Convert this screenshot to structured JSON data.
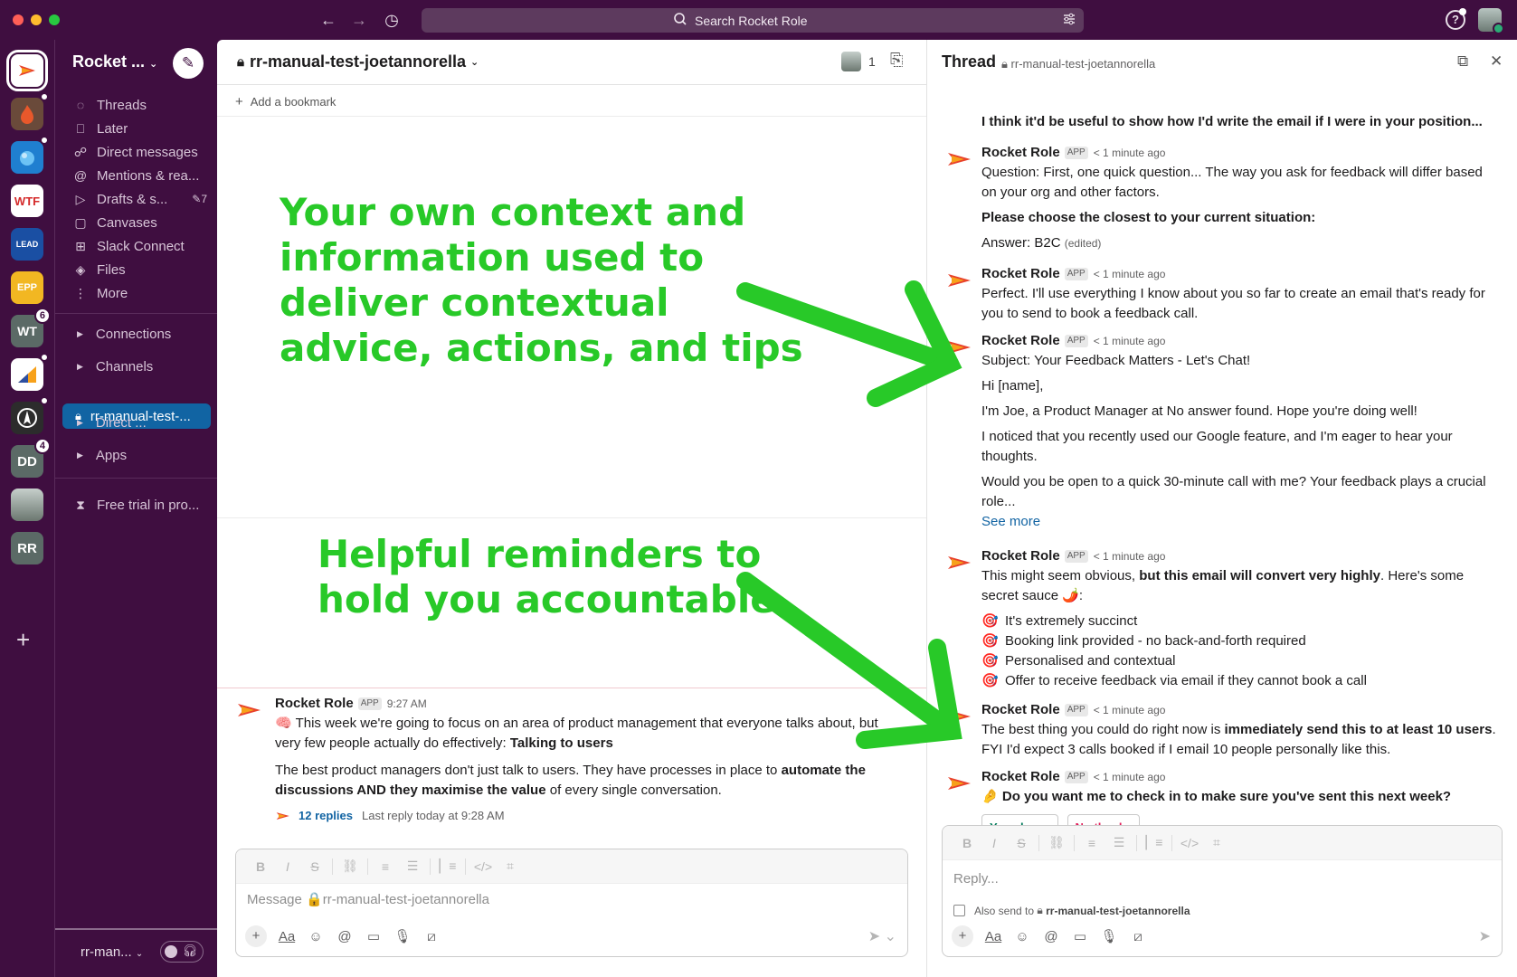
{
  "topbar": {
    "search_placeholder": "Search Rocket Role",
    "back_icon": "arrow-left-icon",
    "forward_icon": "arrow-right-icon",
    "history_icon": "clock-icon"
  },
  "rail": {
    "workspaces": [
      {
        "initials": "",
        "badge": ""
      },
      {
        "initials": "",
        "badge": ""
      },
      {
        "initials": "",
        "badge": ""
      },
      {
        "initials": "WTF",
        "badge": ""
      },
      {
        "initials": "LEAD",
        "badge": ""
      },
      {
        "initials": "EPP",
        "badge": ""
      },
      {
        "initials": "WT",
        "badge": "6"
      },
      {
        "initials": "",
        "badge": ""
      },
      {
        "initials": "",
        "badge": ""
      },
      {
        "initials": "DD",
        "badge": "4"
      },
      {
        "initials": "",
        "badge": ""
      },
      {
        "initials": "RR",
        "badge": ""
      }
    ],
    "add_label": "+"
  },
  "sidebar": {
    "workspace_name": "Rocket ...",
    "nav": [
      {
        "label": "Threads",
        "icon": "threads-icon"
      },
      {
        "label": "Later",
        "icon": "bookmark-icon"
      },
      {
        "label": "Direct messages",
        "icon": "dm-icon"
      },
      {
        "label": "Mentions & rea...",
        "icon": "at-icon"
      },
      {
        "label": "Drafts & s...",
        "icon": "send-icon",
        "extra": "7"
      },
      {
        "label": "Canvases",
        "icon": "canvas-icon"
      },
      {
        "label": "Slack Connect",
        "icon": "connect-icon"
      },
      {
        "label": "Files",
        "icon": "files-icon"
      },
      {
        "label": "More",
        "icon": "more-icon"
      }
    ],
    "sections": {
      "connections": "Connections",
      "channels": "Channels",
      "active_channel": "rr-manual-test-...",
      "direct": "Direct ...",
      "apps": "Apps"
    },
    "free_trial": "Free trial in pro...",
    "footer_name": "rr-man..."
  },
  "channel": {
    "title": "rr-manual-test-joetannorella",
    "member_count": "1",
    "bookmark_label": "Add a bookmark",
    "annotation_top": [
      "Your own context and",
      "information used to",
      "deliver contextual",
      "advice, actions, and tips"
    ],
    "annotation_bottom": [
      "Helpful reminders to",
      "hold you accountable"
    ],
    "message": {
      "author": "Rocket Role",
      "app_tag": "APP",
      "time": "9:27 AM",
      "p1_before": "This week we're going to focus on an area of product management that everyone talks about, but very few people actually do effectively: ",
      "p1_bold": "Talking to users",
      "p2_before": "The best product managers don't just talk to users. They have processes in place to ",
      "p2_bold": "automate the discussions AND they maximise the value",
      "p2_after": " of every single conversation.",
      "replies": "12 replies",
      "last_reply": "Last reply today at 9:28 AM"
    },
    "composer_placeholder": "Message 🔒rr-manual-test-joetannorella"
  },
  "thread": {
    "title": "Thread",
    "channel": "rr-manual-test-joetannorella",
    "top_fragment": "I think it'd be useful to show how I'd write the email if I were in your position...",
    "messages": [
      {
        "author": "Rocket Role",
        "tag": "APP",
        "time": "< 1 minute ago",
        "p1": "Question: First, one quick question... The way you ask for feedback will differ based on your org and other factors.",
        "p2": "Please choose the closest to your current situation:",
        "p3": "Answer: B2C",
        "edited": "(edited)"
      },
      {
        "author": "Rocket Role",
        "tag": "APP",
        "time": "< 1 minute ago",
        "p1": "Perfect. I'll use everything I know about you so far to create an email that's ready for you to send to book a feedback call."
      },
      {
        "author": "Rocket Role",
        "tag": "APP",
        "time": "< 1 minute ago",
        "p1": "Subject: Your Feedback Matters - Let's Chat!",
        "p2": "Hi [name],",
        "p3": "I'm Joe, a Product Manager at No answer found. Hope you're doing well!",
        "p4": "I noticed that you recently used our Google feature, and I'm eager to hear your thoughts.",
        "p5": "Would you be open to a quick 30-minute call with me? Your feedback plays a crucial role...",
        "see_more": "See more"
      },
      {
        "author": "Rocket Role",
        "tag": "APP",
        "time": "< 1 minute ago",
        "p1_before": "This might seem obvious, ",
        "p1_bold": "but this email will convert very highly",
        "p1_after": ". Here's some secret sauce 🌶️:",
        "bullets": [
          "It's extremely succinct",
          "Booking link provided - no back-and-forth required",
          "Personalised and contextual",
          "Offer to receive feedback via email if they cannot book a call"
        ]
      },
      {
        "author": "Rocket Role",
        "tag": "APP",
        "time": "< 1 minute ago",
        "p1_before": "The best thing you could do right now is ",
        "p1_bold": "immediately send this to at least 10 users",
        "p1_after": ". FYI I'd expect 3 calls booked if I email 10 people personally like this."
      },
      {
        "author": "Rocket Role",
        "tag": "APP",
        "time": "< 1 minute ago",
        "p1_bold": "Do you want me to check in to make sure you've sent this next week?",
        "yes": "Yes please",
        "no": "No thanks"
      }
    ],
    "reply_placeholder": "Reply...",
    "also_send_prefix": "Also send to",
    "also_send_channel": "rr-manual-test-joetannorella"
  },
  "colors": {
    "aubergine": "#3f0e40",
    "active_blue": "#1164a3",
    "annotation_green": "#28c928",
    "link_blue": "#1264a3"
  }
}
